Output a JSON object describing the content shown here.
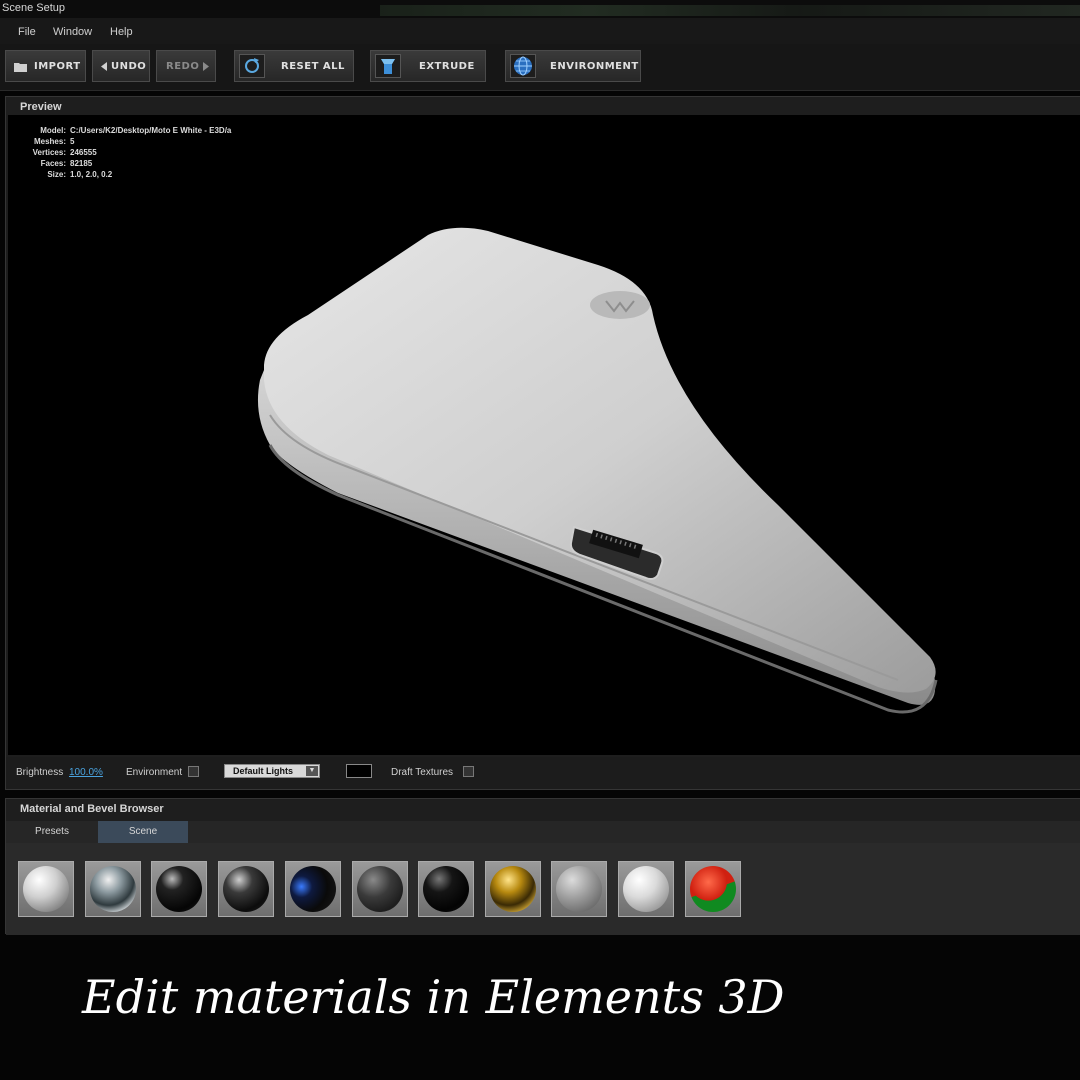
{
  "window": {
    "title": "Scene Setup"
  },
  "menu": {
    "items": [
      "File",
      "Window",
      "Help"
    ]
  },
  "toolbar": {
    "import": "IMPORT",
    "undo": "UNDO",
    "redo": "REDO",
    "reset_all": "RESET ALL",
    "extrude": "EXTRUDE",
    "environment": "ENVIRONMENT"
  },
  "preview": {
    "title": "Preview",
    "stats": {
      "model_label": "Model:",
      "model_value": "C:/Users/K2/Desktop/Moto E White  - E3D/a",
      "meshes_label": "Meshes:",
      "meshes_value": "5",
      "vertices_label": "Vertices:",
      "vertices_value": "246555",
      "faces_label": "Faces:",
      "faces_value": "82185",
      "size_label": "Size:",
      "size_value": "1.0, 2.0, 0.2"
    },
    "bar": {
      "brightness_label": "Brightness",
      "brightness_value": "100.0%",
      "environment_label": "Environment",
      "lights_value": "Default Lights",
      "draft_label": "Draft Textures"
    }
  },
  "materials": {
    "title": "Material and Bevel Browser",
    "tabs": [
      "Presets",
      "Scene"
    ],
    "active_tab": "Scene"
  },
  "caption": "Edit materials in Elements 3D",
  "colors": {
    "accent_blue": "#4aa3df",
    "tab_active": "#3b4a5a"
  }
}
